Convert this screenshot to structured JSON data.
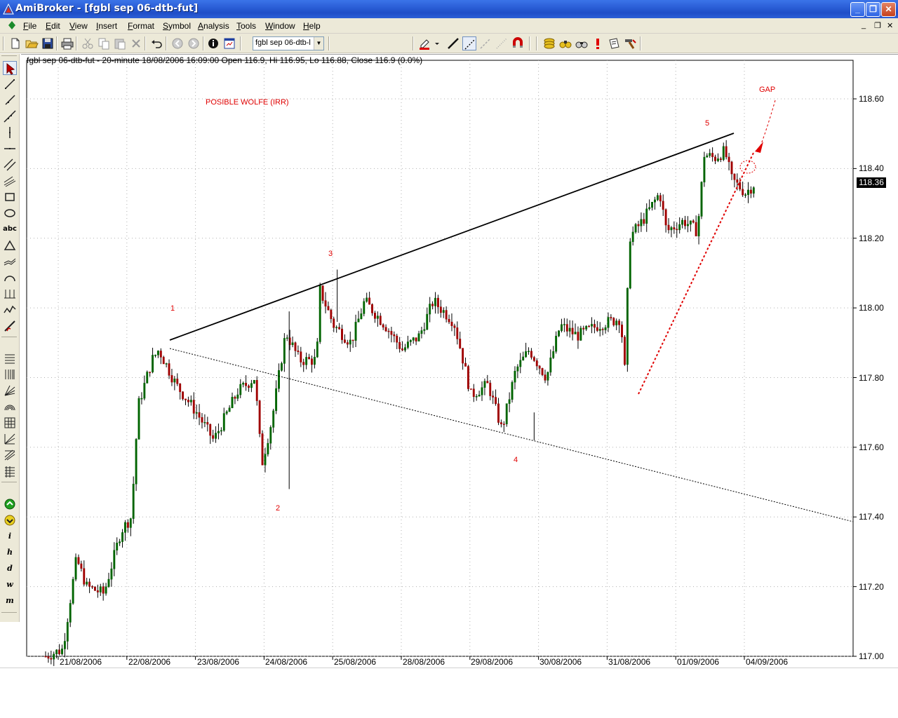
{
  "window": {
    "title": "AmiBroker - [fgbl sep 06-dtb-fut]",
    "minimize": "_",
    "restore": "❐",
    "close": "✕"
  },
  "menu": {
    "items": [
      "File",
      "Edit",
      "View",
      "Insert",
      "Format",
      "Symbol",
      "Analysis",
      "Tools",
      "Window",
      "Help"
    ],
    "mdi_min": "_",
    "mdi_restore": "❐",
    "mdi_close": "✕"
  },
  "toolbar": {
    "symbol_value": "fgbl sep 06-dtb-l",
    "icons": [
      "new-icon",
      "open-icon",
      "save-icon",
      "print-icon",
      "cut-icon",
      "copy-icon",
      "paste-icon",
      "delete-icon",
      "undo-icon",
      "back-icon",
      "forward-icon",
      "stop-icon",
      "info-icon",
      "quote-editor-icon"
    ]
  },
  "drawing_toolbar": {
    "icons": [
      "pen-color-icon",
      "line-style-icon",
      "dotted-line-icon",
      "thick-line-icon",
      "thin-line-icon",
      "magnet-icon",
      "coins-icon",
      "binoculars-icon",
      "alert-icon",
      "notepad-icon",
      "hammer-icon"
    ]
  },
  "left_toolbar": {
    "icons": [
      "select-arrow-icon",
      "trendline-icon",
      "ray-icon",
      "extended-line-icon",
      "vertical-line-icon",
      "horizontal-line-icon",
      "parallel-lines-icon",
      "channel-icon",
      "rectangle-icon",
      "ellipse-icon",
      "text-icon",
      "triangle-icon",
      "wave-icon",
      "arc-icon",
      "cycles-icon",
      "zigzag-icon",
      "fib-retracement-icon",
      "fib-extension-icon",
      "fib-timezones-icon",
      "gann-fan-icon",
      "fib-arcs-icon",
      "gann-square-icon",
      "gann-angles-icon",
      "andrews-pitchfork-icon",
      "fib-lines-icon",
      "buy-marker-icon",
      "sell-marker-icon"
    ],
    "abc_label": "abc",
    "letters": [
      "i",
      "h",
      "d",
      "w",
      "m"
    ]
  },
  "chart": {
    "header": "fgbl sep 06-dtb-fut - 20-minute 18/08/2006 16:09:00 Open 116.9, Hi 116.95, Lo 116.88, Close 116.9 (0.0%)",
    "annotations": {
      "title": "POSIBLE WOLFE (IRR)",
      "gap": "GAP",
      "p1": "1",
      "p2": "2",
      "p3": "3",
      "p4": "4",
      "p5": "5"
    },
    "last_price": "118.36",
    "accent_color": "#e00000",
    "up_color": "#006400",
    "down_color": "#a00000"
  },
  "chart_data": {
    "type": "candlestick",
    "title": "fgbl sep 06-dtb-fut - 20-minute",
    "ylim": [
      117.0,
      118.75
    ],
    "y_ticks": [
      "118.60",
      "118.40",
      "118.20",
      "118.00",
      "117.80",
      "117.60",
      "117.40",
      "117.20",
      "117.00"
    ],
    "x_ticks": [
      "21/08/2006",
      "22/08/2006",
      "23/08/2006",
      "24/08/2006",
      "25/08/2006",
      "28/08/2006",
      "29/08/2006",
      "30/08/2006",
      "31/08/2006",
      "01/09/2006",
      "04/09/2006"
    ],
    "price_path": [
      {
        "t": 0.0,
        "p": 117.0
      },
      {
        "t": 0.25,
        "p": 117.02
      },
      {
        "t": 0.45,
        "p": 117.28
      },
      {
        "t": 0.6,
        "p": 117.2
      },
      {
        "t": 0.85,
        "p": 117.18
      },
      {
        "t": 1.1,
        "p": 117.36
      },
      {
        "t": 1.25,
        "p": 117.4
      },
      {
        "t": 1.35,
        "p": 117.72
      },
      {
        "t": 1.55,
        "p": 117.85
      },
      {
        "t": 1.65,
        "p": 117.88
      },
      {
        "t": 1.9,
        "p": 117.78
      },
      {
        "t": 2.2,
        "p": 117.7
      },
      {
        "t": 2.45,
        "p": 117.62
      },
      {
        "t": 2.8,
        "p": 117.76
      },
      {
        "t": 3.05,
        "p": 117.8
      },
      {
        "t": 3.15,
        "p": 117.55
      },
      {
        "t": 3.3,
        "p": 117.68
      },
      {
        "t": 3.5,
        "p": 117.93
      },
      {
        "t": 3.7,
        "p": 117.85
      },
      {
        "t": 3.95,
        "p": 117.85
      },
      {
        "t": 4.0,
        "p": 118.05
      },
      {
        "t": 4.2,
        "p": 117.95
      },
      {
        "t": 4.45,
        "p": 117.9
      },
      {
        "t": 4.65,
        "p": 118.02
      },
      {
        "t": 4.95,
        "p": 117.95
      },
      {
        "t": 5.2,
        "p": 117.88
      },
      {
        "t": 5.45,
        "p": 117.92
      },
      {
        "t": 5.65,
        "p": 118.02
      },
      {
        "t": 5.95,
        "p": 117.96
      },
      {
        "t": 6.05,
        "p": 117.88
      },
      {
        "t": 6.2,
        "p": 117.75
      },
      {
        "t": 6.45,
        "p": 117.78
      },
      {
        "t": 6.65,
        "p": 117.65
      },
      {
        "t": 6.85,
        "p": 117.82
      },
      {
        "t": 7.05,
        "p": 117.88
      },
      {
        "t": 7.3,
        "p": 117.8
      },
      {
        "t": 7.5,
        "p": 117.95
      },
      {
        "t": 7.75,
        "p": 117.92
      },
      {
        "t": 8.05,
        "p": 117.95
      },
      {
        "t": 8.38,
        "p": 117.97
      },
      {
        "t": 8.45,
        "p": 117.8
      },
      {
        "t": 8.5,
        "p": 118.2
      },
      {
        "t": 8.7,
        "p": 118.25
      },
      {
        "t": 8.95,
        "p": 118.33
      },
      {
        "t": 9.05,
        "p": 118.22
      },
      {
        "t": 9.3,
        "p": 118.25
      },
      {
        "t": 9.5,
        "p": 118.22
      },
      {
        "t": 9.6,
        "p": 118.44
      },
      {
        "t": 9.75,
        "p": 118.43
      },
      {
        "t": 9.9,
        "p": 118.45
      },
      {
        "t": 10.0,
        "p": 118.37
      },
      {
        "t": 10.2,
        "p": 118.33
      },
      {
        "t": 10.35,
        "p": 118.36
      }
    ]
  }
}
